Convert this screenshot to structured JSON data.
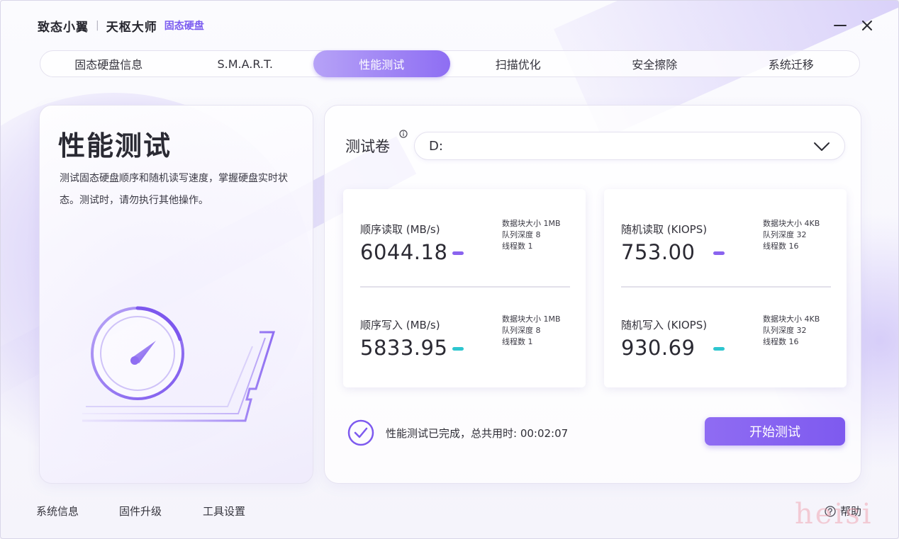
{
  "titlebar": {
    "brand_primary": "致态小翼",
    "separator": "|",
    "brand_secondary": "天枢大师",
    "brand_tag": "固态硬盘",
    "minimize_icon": "minimize-icon",
    "close_icon": "close-icon"
  },
  "tabs": [
    {
      "label": "固态硬盘信息",
      "active": false
    },
    {
      "label": "S.M.A.R.T.",
      "active": false
    },
    {
      "label": "性能测试",
      "active": true
    },
    {
      "label": "扫描优化",
      "active": false
    },
    {
      "label": "安全擦除",
      "active": false
    },
    {
      "label": "系统迁移",
      "active": false
    }
  ],
  "intro": {
    "title": "性能测试",
    "description": "测试固态硬盘顺序和随机读写速度，掌握硬盘实时状态。测试时，请勿执行其他操作。",
    "illustration_icon": "speedometer-icon"
  },
  "volume": {
    "label": "测试卷",
    "info_icon": "info-icon",
    "selected": "D:",
    "dropdown_icon": "chevron-down-icon"
  },
  "results": {
    "sequential": {
      "read": {
        "label": "顺序读取 (MB/s)",
        "value": "6044.18",
        "block_size": "数据块大小 1MB",
        "queue_depth": "队列深度 8",
        "threads": "线程数 1",
        "color": "#8a63ef"
      },
      "write": {
        "label": "顺序写入 (MB/s)",
        "value": "5833.95",
        "block_size": "数据块大小 1MB",
        "queue_depth": "队列深度 8",
        "threads": "线程数 1",
        "color": "#2ec6cf"
      }
    },
    "random": {
      "read": {
        "label": "随机读取 (KIOPS)",
        "value": "753.00",
        "block_size": "数据块大小 4KB",
        "queue_depth": "队列深度 32",
        "threads": "线程数 16",
        "color": "#8a63ef"
      },
      "write": {
        "label": "随机写入 (KIOPS)",
        "value": "930.69",
        "block_size": "数据块大小 4KB",
        "queue_depth": "队列深度 32",
        "threads": "线程数 16",
        "color": "#2ec6cf"
      }
    }
  },
  "status": {
    "icon": "check-circle-icon",
    "text": "性能测试已完成，总共用时: 00:02:07"
  },
  "actions": {
    "start_label": "开始测试"
  },
  "footer": {
    "system_info": "系统信息",
    "firmware_upgrade": "固件升级",
    "tool_settings": "工具设置",
    "help": "帮助",
    "help_icon": "help-icon"
  },
  "watermark": "heisi",
  "colors": {
    "accent": "#8a63ef",
    "accent_light": "#b6a2f7",
    "write_indicator": "#2ec6cf"
  }
}
